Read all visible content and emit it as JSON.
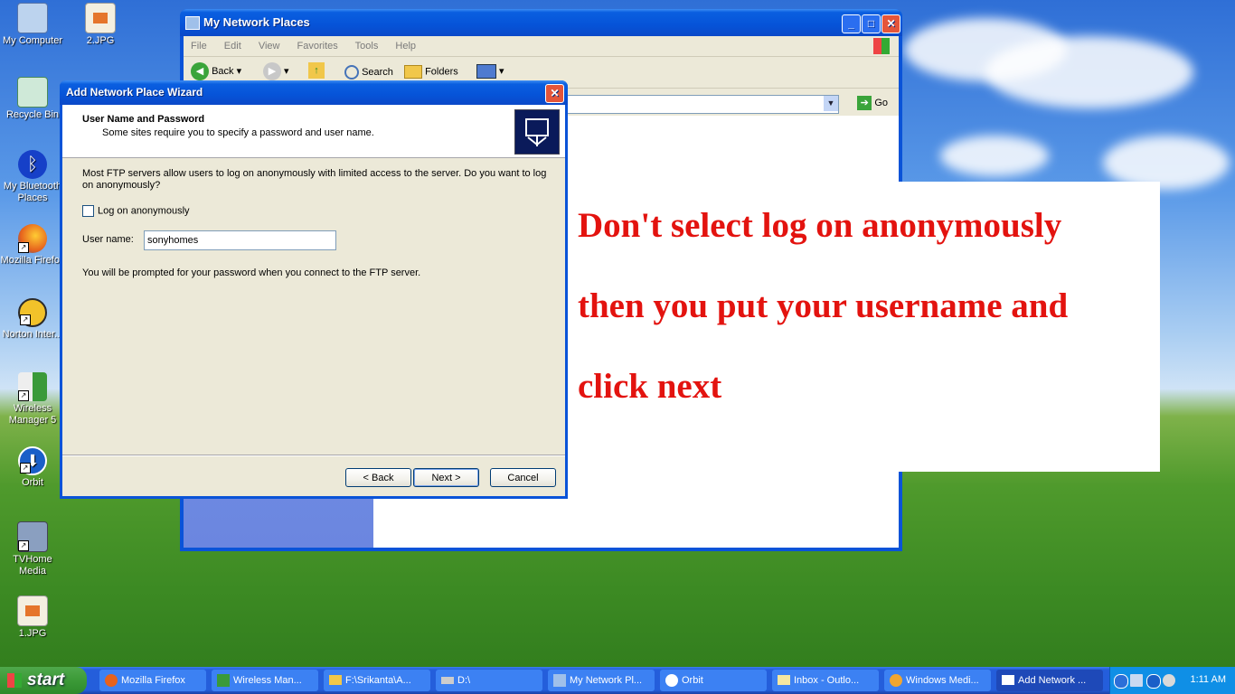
{
  "desktop": {
    "icons": [
      {
        "label": "My Computer"
      },
      {
        "label": "2.JPG"
      },
      {
        "label": "Recycle Bin"
      },
      {
        "label": "My Bluetooth Places"
      },
      {
        "label": "Mozilla Firefox"
      },
      {
        "label": "Norton Inter..."
      },
      {
        "label": "Wireless Manager 5"
      },
      {
        "label": "Orbit"
      },
      {
        "label": "TVHome Media"
      },
      {
        "label": "1.JPG"
      }
    ]
  },
  "explorer": {
    "title": "My Network Places",
    "menu": [
      "File",
      "Edit",
      "View",
      "Favorites",
      "Tools",
      "Help"
    ],
    "toolbar": {
      "back": "Back",
      "search": "Search",
      "folders": "Folders"
    },
    "go_label": "Go"
  },
  "wizard": {
    "title": "Add Network Place Wizard",
    "heading": "User Name and Password",
    "subheading": "Some sites require you to specify a password and user name.",
    "description": "Most FTP servers allow users to log on anonymously with limited access to the server.  Do you want to log on anonymously?",
    "anonymous_label": "Log on anonymously",
    "anonymous_checked": false,
    "username_label": "User name:",
    "username_value": "sonyhomes",
    "note": "You will be prompted for your password when you connect to the FTP server.",
    "back_label": "< Back",
    "next_label": "Next >",
    "cancel_label": "Cancel"
  },
  "annotation": {
    "line1": "Don't select log on anonymously",
    "line2": "then you put your username and",
    "line3": "click next",
    "color": "#e3130f"
  },
  "taskbar": {
    "start_label": "start",
    "tasks": [
      {
        "label": "Mozilla Firefox"
      },
      {
        "label": "Wireless Man..."
      },
      {
        "label": "F:\\Srikanta\\A..."
      },
      {
        "label": "D:\\"
      },
      {
        "label": "My Network Pl..."
      },
      {
        "label": "Orbit"
      },
      {
        "label": "Inbox - Outlo..."
      },
      {
        "label": "Windows Medi..."
      },
      {
        "label": "Add Network ..."
      }
    ],
    "clock": "1:11 AM"
  }
}
